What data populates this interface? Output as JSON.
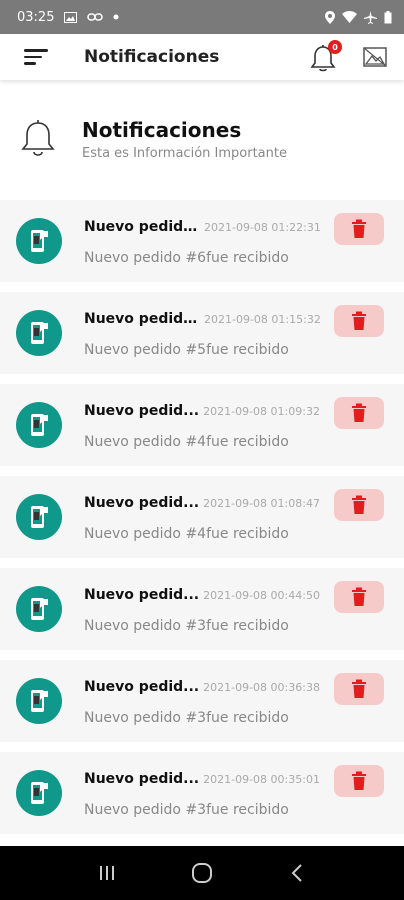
{
  "status_bar": {
    "time": "03:25",
    "icons": [
      "image-icon",
      "link-icon",
      "dot-icon",
      "location-icon",
      "wifi-icon",
      "airplane-icon",
      "battery-icon"
    ]
  },
  "app_bar": {
    "title": "Notificaciones",
    "badge_count": "0",
    "icons": [
      "menu-icon",
      "bell-icon",
      "image-icon"
    ]
  },
  "header": {
    "title": "Notificaciones",
    "subtitle": "Esta es Información Importante",
    "icon": "bell-icon"
  },
  "notifications": [
    {
      "title": "Nuevo pedido...",
      "date": "2021-09-08 01:22:31",
      "message": "Nuevo pedido #6fue recibido"
    },
    {
      "title": "Nuevo pedido...",
      "date": "2021-09-08 01:15:32",
      "message": "Nuevo pedido #5fue recibido"
    },
    {
      "title": "Nuevo pedid...",
      "date": "2021-09-08 01:09:32",
      "message": "Nuevo pedido #4fue recibido"
    },
    {
      "title": "Nuevo pedid...",
      "date": "2021-09-08 01:08:47",
      "message": "Nuevo pedido #4fue recibido"
    },
    {
      "title": "Nuevo pedid...",
      "date": "2021-09-08 00:44:50",
      "message": "Nuevo pedido #3fue recibido"
    },
    {
      "title": "Nuevo pedid...",
      "date": "2021-09-08 00:36:38",
      "message": "Nuevo pedido #3fue recibido"
    },
    {
      "title": "Nuevo pedid...",
      "date": "2021-09-08 00:35:01",
      "message": "Nuevo pedido #3fue recibido"
    }
  ],
  "colors": {
    "accent": "#10998a",
    "delete_bg": "#f7caca",
    "delete_icon": "#e11d1d",
    "badge": "#e11d1d"
  },
  "nav_bar": {
    "icons": [
      "recents-icon",
      "home-icon",
      "back-icon"
    ]
  }
}
